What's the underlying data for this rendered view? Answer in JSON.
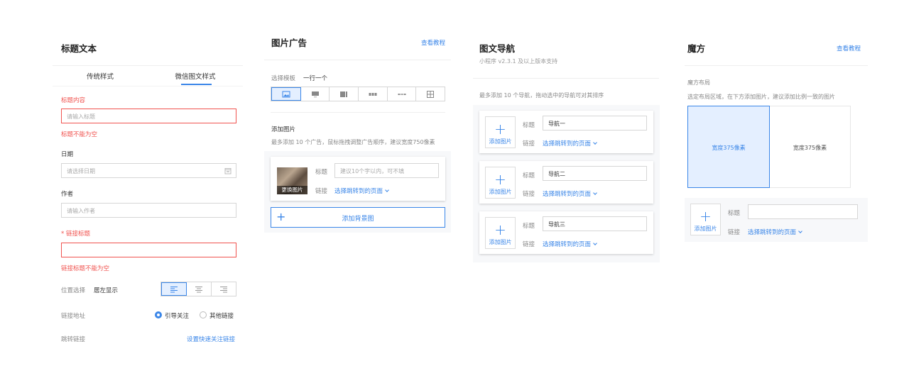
{
  "panel1": {
    "title": "标题文本",
    "tabs": [
      "传统样式",
      "微信图文样式"
    ],
    "content_label": "标题内容",
    "content_placeholder": "请输入标题",
    "content_error": "标题不能为空",
    "date_label": "日期",
    "date_placeholder": "请选择日期",
    "author_label": "作者",
    "author_placeholder": "请输入作者",
    "link_title_star": "*",
    "link_title_label": "链接标题",
    "link_title_error": "链接标题不能为空",
    "position_label": "位置选择",
    "position_value": "居左显示",
    "link_addr_label": "链接地址",
    "radio_follow": "引导关注",
    "radio_other": "其他链接",
    "jump_label": "跳转链接",
    "jump_action": "设置快速关注链接"
  },
  "panel2": {
    "title": "图片广告",
    "tutorial": "查看教程",
    "template_label": "选择模板",
    "template_value": "一行一个",
    "add_image_label": "添加图片",
    "add_image_hint": "最多添加 10 个广告，鼠标拖拽调整广告顺序，建议宽度750像素",
    "change_image": "更换图片",
    "title_label": "标题",
    "title_placeholder": "建议10个字以内，可不填",
    "link_label": "链接",
    "link_select": "选择跳转到的页面",
    "add_bg": "添加背景图",
    "plus": "+"
  },
  "panel3": {
    "title": "图文导航",
    "subtitle": "小程序 v2.3.1 及以上版本支持",
    "hint": "最多添加 10 个导航，拖动选中的导航可对其排序",
    "add_image": "添加图片",
    "title_label": "标题",
    "link_label": "链接",
    "link_select": "选择跳转到的页面",
    "plus": "+",
    "items": [
      {
        "title": "导航一"
      },
      {
        "title": "导航二"
      },
      {
        "title": "导航三"
      }
    ]
  },
  "panel4": {
    "title": "魔方",
    "tutorial": "查看教程",
    "layout_label": "魔方布局",
    "layout_hint": "选定布局区域，在下方添加图片，建议添加比例一致的图片",
    "cell_left": "宽度375像素",
    "cell_right": "宽度375像素",
    "add_image": "添加图片",
    "title_label": "标题",
    "link_label": "链接",
    "link_select": "选择跳转到的页面",
    "plus": "+"
  },
  "colors": {
    "accent": "#3a86e8",
    "error": "#f0534f",
    "selected_bg": "#e4efff"
  }
}
